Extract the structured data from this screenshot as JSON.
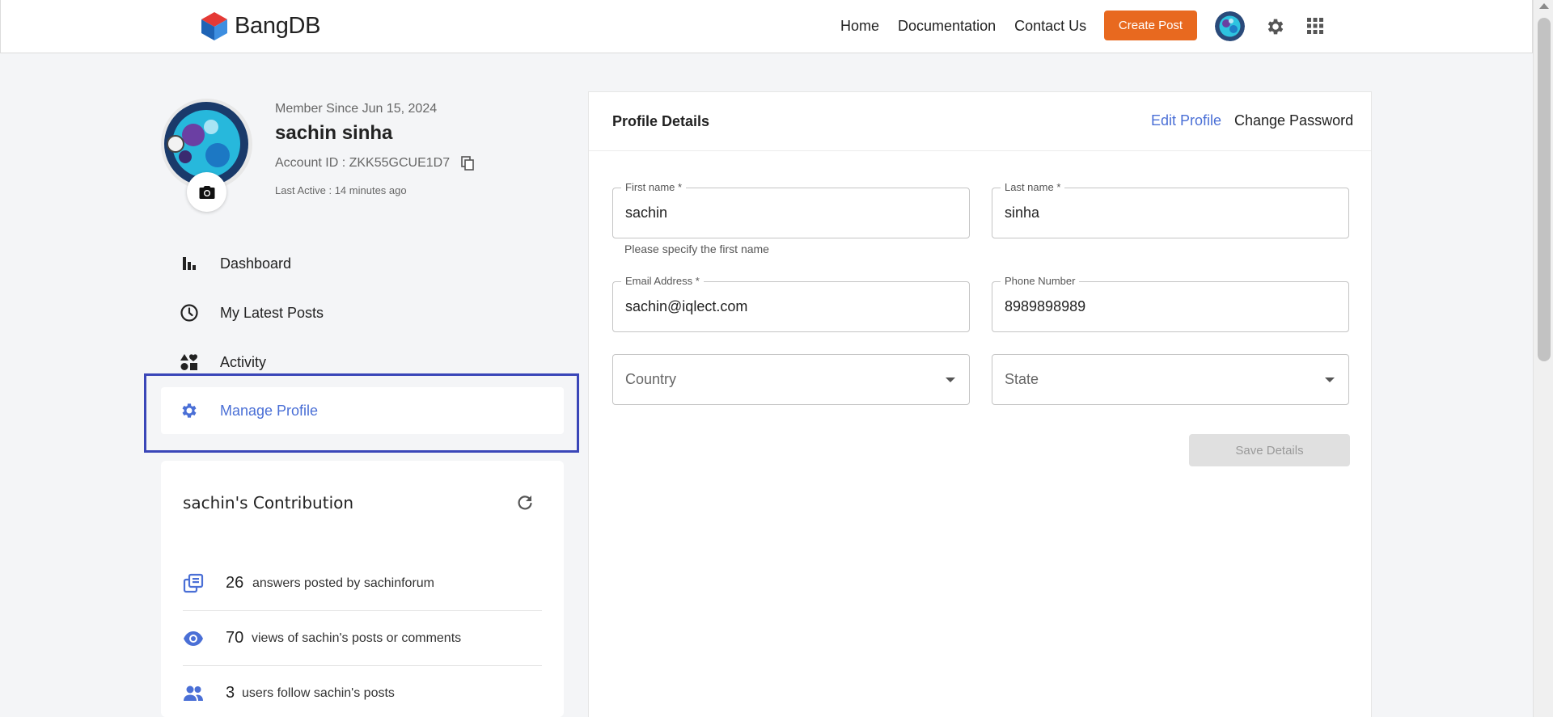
{
  "header": {
    "logo_text": "BangDB",
    "nav": [
      "Home",
      "Documentation",
      "Contact Us"
    ],
    "create_post_label": "Create Post"
  },
  "profile": {
    "member_since": "Member Since Jun 15, 2024",
    "name": "sachin sinha",
    "account_id": "Account ID : ZKK55GCUE1D7",
    "last_active": "Last Active : 14 minutes ago"
  },
  "sidebar": {
    "items": [
      {
        "label": "Dashboard",
        "icon": "bar-chart-icon"
      },
      {
        "label": "My Latest Posts",
        "icon": "clock-icon"
      },
      {
        "label": "Activity",
        "icon": "shapes-icon"
      },
      {
        "label": "Manage Profile",
        "icon": "gear-icon",
        "active": true
      }
    ]
  },
  "contribution": {
    "title": "sachin's Contribution",
    "stats": [
      {
        "value": "26",
        "text": "answers posted by sachinforum",
        "icon": "library-icon"
      },
      {
        "value": "70",
        "text": "views of sachin's posts or comments",
        "icon": "eye-icon"
      },
      {
        "value": "3",
        "text": "users follow sachin's posts",
        "icon": "people-icon"
      }
    ]
  },
  "details": {
    "title": "Profile Details",
    "edit_profile": "Edit Profile",
    "change_password": "Change Password",
    "first_name_label": "First name *",
    "first_name_value": "sachin",
    "first_name_helper": "Please specify the first name",
    "last_name_label": "Last name *",
    "last_name_value": "sinha",
    "email_label": "Email Address *",
    "email_value": "sachin@iqlect.com",
    "phone_label": "Phone Number",
    "phone_value": "8989898989",
    "country_placeholder": "Country",
    "state_placeholder": "State",
    "save_label": "Save Details"
  },
  "colors": {
    "accent": "#4a6fd6",
    "create_button": "#e8691f",
    "highlight": "#3a46b8"
  }
}
